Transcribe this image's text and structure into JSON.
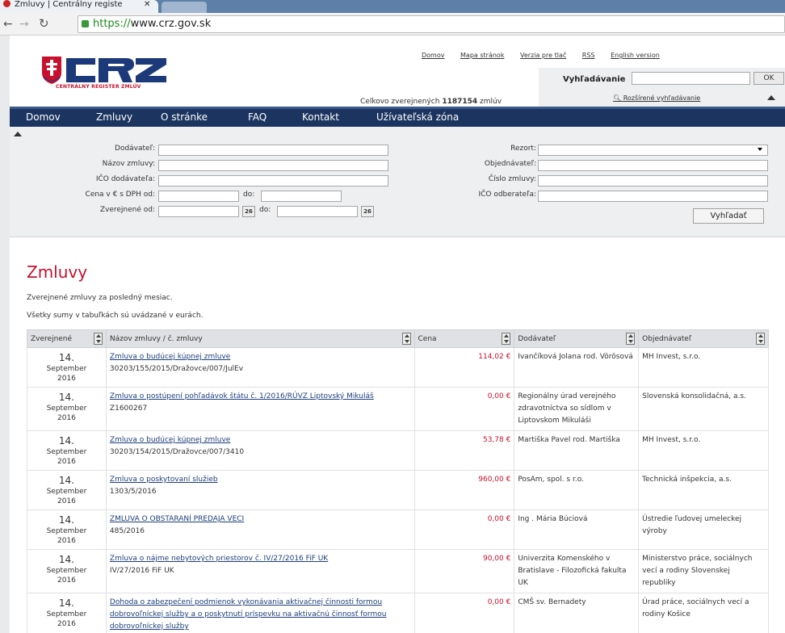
{
  "browser": {
    "tab_title": "Zmluvy | Centrálny registe",
    "url_https": "https://",
    "url_rest": "www.crz.gov.sk"
  },
  "header": {
    "logo_text": "CENTRÁLNY REGISTER ZMLÚV",
    "links": [
      "Domov",
      "Mapa stránok",
      "Verzia pre tlač",
      "RSS",
      "English version"
    ],
    "search_label": "Vyhľadávanie",
    "search_placeholder": "",
    "ok_label": "OK",
    "advanced_search": "Rozšírené vyhľadávanie",
    "total_prefix": "Celkovo zverejnených ",
    "total_count": "1187154",
    "total_suffix": " zmlúv"
  },
  "nav": [
    "Domov",
    "Zmluvy",
    "O stránke",
    "FAQ",
    "Kontakt",
    "Užívateľská zóna"
  ],
  "filter": {
    "dodavatel": "Dodávateľ:",
    "nazov": "Názov zmluvy:",
    "ico_dod": "IČO dodávateľa:",
    "cena_od": "Cena v € s DPH od:",
    "cena_do": "do:",
    "zverej_od": "Zverejnené od:",
    "zverej_do": "do:",
    "rezort": "Rezort:",
    "objednavatel": "Objednávateľ:",
    "cislo": "Číslo zmluvy:",
    "ico_odb": "IČO odberateľa:",
    "search_button": "Vyhľadať",
    "cal_day": "26"
  },
  "main": {
    "title": "Zmluvy",
    "subtitle1": "Zverejnené zmluvy za posledný mesiac.",
    "subtitle2": "Všetky sumy v tabuľkách sú uvádzané v eurách."
  },
  "table": {
    "headers": [
      "Zverejnené",
      "Názov zmluvy / č. zmluvy",
      "Cena",
      "Dodávateľ",
      "Objednávateľ"
    ],
    "rows": [
      {
        "day": "14.",
        "month": "September",
        "year": "2016",
        "title": "Zmluva o budúcej kúpnej zmluve",
        "number": "30203/155/2015/Dražovce/007/JulEv",
        "price": "114,02 €",
        "supplier": "Ivančíková Jolana rod. Vörösová",
        "buyer": "MH Invest, s.r.o."
      },
      {
        "day": "14.",
        "month": "September",
        "year": "2016",
        "title": "Zmluva o postúpení pohľadávok štátu č. 1/2016/RÚVZ Liptovský Mikuláš",
        "number": "Z1600267",
        "price": "0,00 €",
        "supplier": "Regionálny úrad verejného zdravotníctva so sídlom v Liptovskom Mikuláši",
        "buyer": "Slovenská konsolidačná, a.s."
      },
      {
        "day": "14.",
        "month": "September",
        "year": "2016",
        "title": "Zmluva o budúcej kúpnej zmluve",
        "number": "30203/154/2015/Dražovce/007/3410",
        "price": "53,78 €",
        "supplier": "Martiška Pavel rod. Martiška",
        "buyer": "MH Invest, s.r.o."
      },
      {
        "day": "14.",
        "month": "September",
        "year": "2016",
        "title": "Zmluva o poskytovaní služieb",
        "number": "1303/5/2016",
        "price": "960,00 €",
        "supplier": "PosAm, spol. s r.o.",
        "buyer": "Technická inšpekcia, a.s."
      },
      {
        "day": "14.",
        "month": "September",
        "year": "2016",
        "title": "ZMLUVA O OBSTARANÍ PREDAJA VECI",
        "number": "485/2016",
        "price": "0,00 €",
        "supplier": "Ing . Mária Búciová",
        "buyer": "Ústredie ľudovej umeleckej výroby"
      },
      {
        "day": "14.",
        "month": "September",
        "year": "2016",
        "title": "Zmluva o nájme nebytových priestorov č. IV/27/2016 FiF UK",
        "number": "IV/27/2016 FiF UK",
        "price": "90,00 €",
        "supplier": "Univerzita Komenského v Bratislave - Filozofická fakulta UK",
        "buyer": "Ministerstvo práce, sociálnych vecí a rodiny Slovenskej republiky"
      },
      {
        "day": "14.",
        "month": "September",
        "year": "2016",
        "title": "Dohoda o zabezpečení podmienok vykonávania aktivačnej činnosti formou dobrovoľníckej služby a o poskytnutí príspevku na aktivačnú činnosť formou dobrovoľníckej služby",
        "number": "",
        "price": "0,00 €",
        "supplier": "CMŠ sv. Bernadety",
        "buyer": "Úrad práce, sociálnych vecí a rodiny Košice"
      }
    ]
  },
  "colors": {
    "nav_bg": "#1c3560",
    "accent_red": "#c8102e",
    "link_blue": "#1d3e7a"
  }
}
